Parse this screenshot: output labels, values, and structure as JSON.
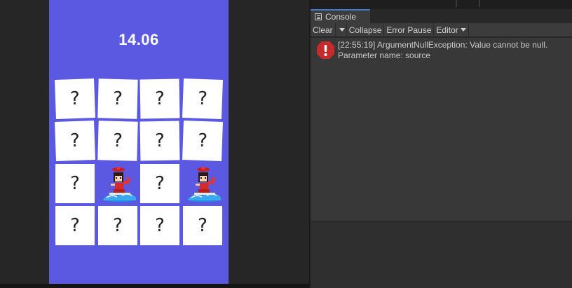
{
  "game": {
    "timer": "14.06",
    "cards": [
      {
        "label": "?",
        "revealed": false
      },
      {
        "label": "?",
        "revealed": false
      },
      {
        "label": "?",
        "revealed": false
      },
      {
        "label": "?",
        "revealed": false
      },
      {
        "label": "?",
        "revealed": false
      },
      {
        "label": "?",
        "revealed": false
      },
      {
        "label": "?",
        "revealed": false
      },
      {
        "label": "?",
        "revealed": false
      },
      {
        "label": "?",
        "revealed": false
      },
      {
        "label": "",
        "revealed": true
      },
      {
        "label": "?",
        "revealed": false
      },
      {
        "label": "",
        "revealed": true
      },
      {
        "label": "?",
        "revealed": false
      },
      {
        "label": "?",
        "revealed": false
      },
      {
        "label": "?",
        "revealed": false
      },
      {
        "label": "?",
        "revealed": false
      }
    ],
    "colors": {
      "background": "#5b58e2",
      "card": "#ffffff"
    }
  },
  "console": {
    "tab_label": "Console",
    "toolbar": {
      "clear": "Clear",
      "collapse": "Collapse",
      "error_pause": "Error Pause",
      "editor": "Editor"
    },
    "log": {
      "type": "error",
      "line1": "[22:55:19] ArgumentNullException: Value cannot be null.",
      "line2": "Parameter name: source",
      "icon": "error-icon",
      "icon_color": "#c62b2b"
    }
  }
}
